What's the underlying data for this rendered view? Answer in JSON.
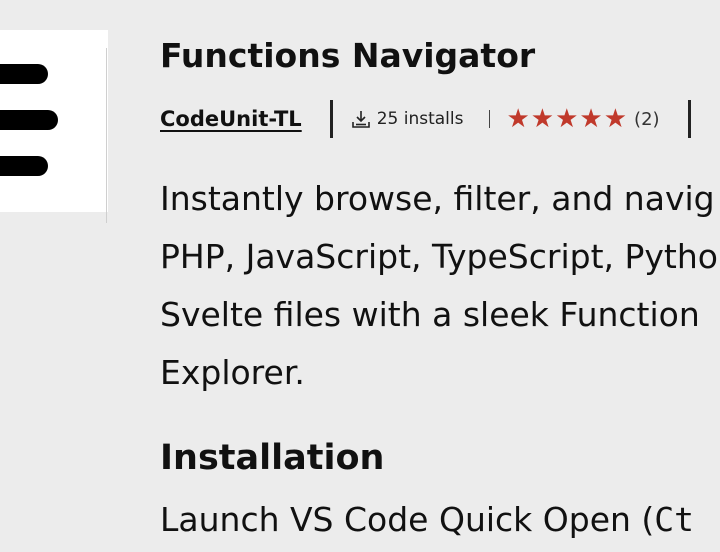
{
  "extension": {
    "name": "Functions Navigator",
    "icon": "hamburger-menu-icon",
    "publisher": "CodeUnit-TL",
    "installs": "25 installs",
    "install_icon": "download-icon",
    "rating": {
      "stars": 5,
      "count": "(2)",
      "color": "#c0392b"
    },
    "description_lines": [
      "Instantly browse, filter, and navig",
      "PHP, JavaScript, TypeScript, Pytho",
      "Svelte files with a sleek Function",
      "Explorer."
    ]
  },
  "installation": {
    "heading": "Installation",
    "text": "Launch VS Code Quick Open (",
    "shortcut": "Ct"
  }
}
